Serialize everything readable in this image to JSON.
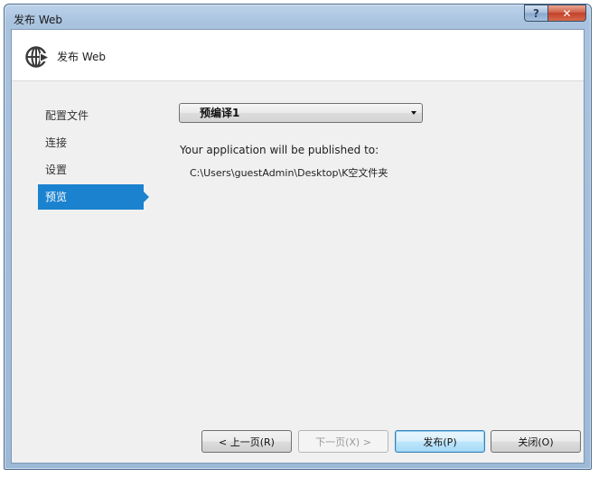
{
  "window": {
    "title": "发布 Web",
    "help_label": "?",
    "close_label": "✕"
  },
  "header": {
    "icon": "globe-publish-icon",
    "title": "发布 Web"
  },
  "nav": {
    "items": [
      {
        "label": "配置文件"
      },
      {
        "label": "连接"
      },
      {
        "label": "设置"
      },
      {
        "label": "预览"
      }
    ],
    "active_index": 3
  },
  "main": {
    "profile_selected": "预编译1",
    "publish_info": "Your application will be published to:",
    "publish_path": "C:\\Users\\guestAdmin\\Desktop\\K空文件夹"
  },
  "buttons": {
    "prev": "< 上一页(R)",
    "next": "下一页(X) >",
    "publish": "发布(P)",
    "close": "关闭(O)"
  },
  "colors": {
    "accent": "#1b82d0",
    "client_bg": "#f0f0f0"
  }
}
